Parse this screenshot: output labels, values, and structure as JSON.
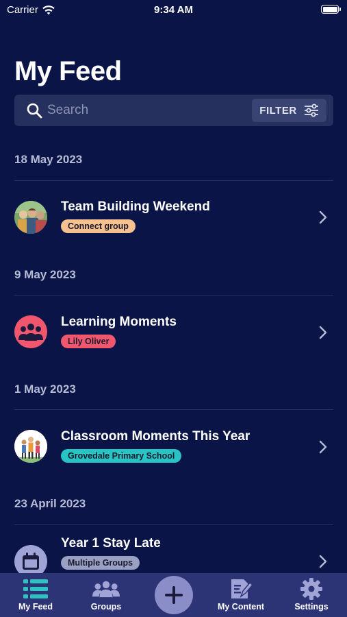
{
  "status_bar": {
    "carrier": "Carrier",
    "time": "9:34 AM"
  },
  "page_title": "My Feed",
  "search": {
    "placeholder": "Search",
    "filter_label": "FILTER"
  },
  "feed": [
    {
      "date": "18 May 2023",
      "title": "Team Building Weekend",
      "tag": "Connect group",
      "tag_color": "#f6c08f",
      "avatar": "photo-group"
    },
    {
      "date": "9 May 2023",
      "title": "Learning Moments",
      "tag": "Lily Oliver",
      "tag_color": "#f0576f",
      "avatar": "people-icon"
    },
    {
      "date": "1 May 2023",
      "title": "Classroom Moments This Year",
      "tag": "Grovedale Primary School",
      "tag_color": "#28c3c3",
      "avatar": "photo-children"
    },
    {
      "date": "23 April 2023",
      "title": "Year 1 Stay Late",
      "tag": "Multiple Groups",
      "tag_color": "#9aa0c3",
      "avatar": "calendar-icon"
    }
  ],
  "tabbar": {
    "my_feed": "My Feed",
    "groups": "Groups",
    "my_content": "My Content",
    "settings": "Settings"
  },
  "colors": {
    "background": "#0a1446",
    "accent_purple": "#8a8dc7",
    "tab_active": "#2fc2c2"
  }
}
